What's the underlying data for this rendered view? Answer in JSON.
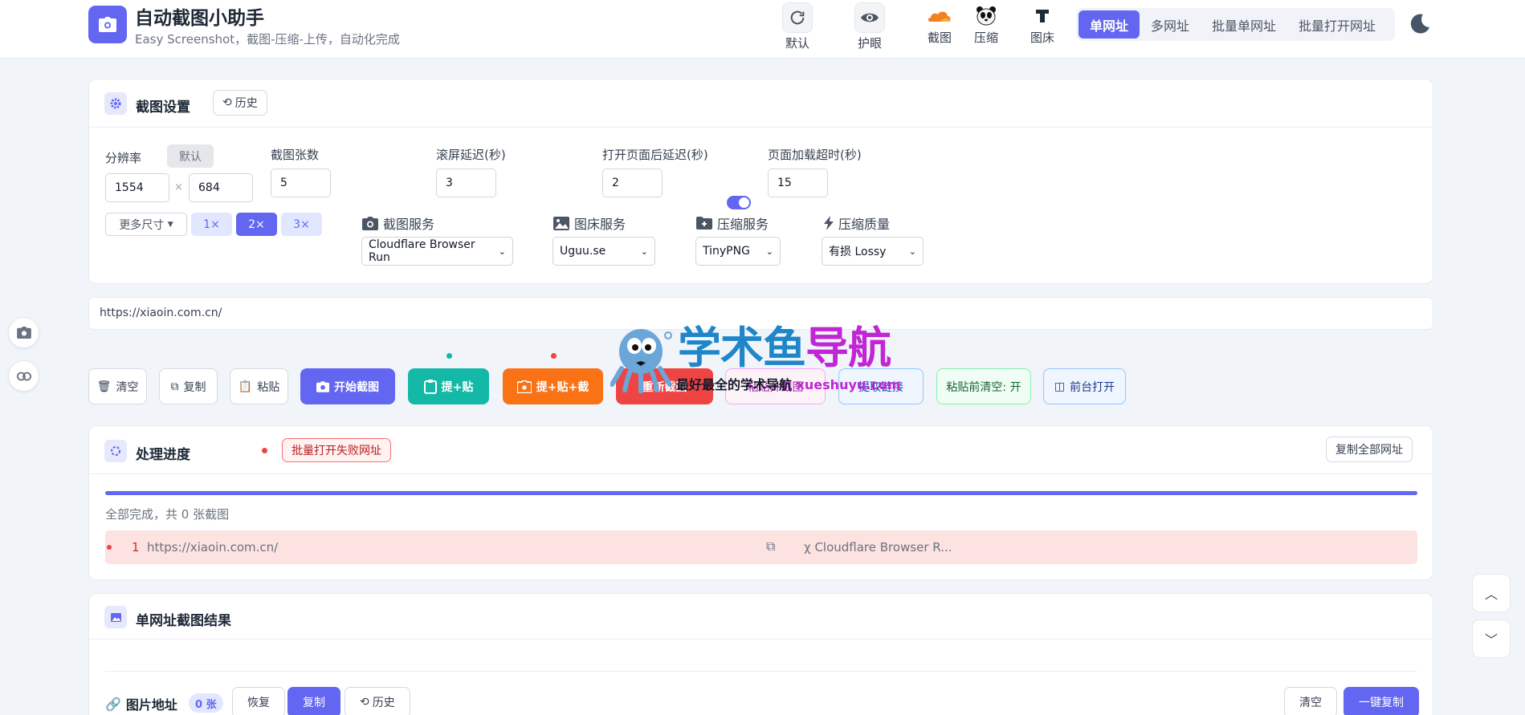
{
  "header": {
    "title": "自动截图小助手",
    "subtitle": "Easy Screenshot，截图-压缩-上传，自动化完成",
    "buttons": {
      "default": "默认",
      "eye": "护眼"
    },
    "services": {
      "screenshot": "截图",
      "compress": "压缩",
      "imagehost": "图床"
    },
    "modes": [
      "单网址",
      "多网址",
      "批量单网址",
      "批量打开网址"
    ]
  },
  "settings": {
    "title": "截图设置",
    "history": "历史",
    "resolution_label": "分辨率",
    "default_chip": "默认",
    "width": "1554",
    "height": "684",
    "times": "×",
    "more_sizes": "更多尺寸",
    "scales": [
      "1×",
      "2×",
      "3×"
    ],
    "count_label": "截图张数",
    "count": "5",
    "scroll_label": "滚屏延迟(秒)",
    "scroll": "3",
    "open_delay_label": "打开页面后延迟(秒)",
    "open_delay": "2",
    "timeout_label": "页面加载超时(秒)",
    "timeout": "15",
    "screenshot_service_label": "截图服务",
    "screenshot_service": "Cloudflare Browser Run",
    "imagehost_label": "图床服务",
    "imagehost": "Uguu.se",
    "compress_label": "压缩服务",
    "compress": "TinyPNG",
    "quality_label": "压缩质量",
    "quality": "有损 Lossy"
  },
  "url_input": {
    "value": "https://xiaoin.com.cn/"
  },
  "actions": {
    "clear": "清空",
    "copy": "复制",
    "paste": "粘贴",
    "start": "开始截图",
    "paste_combo": "提+贴",
    "paste_capture": "提+贴+截",
    "red_btn": "重新截图",
    "pink_btn": "粘贴并截图",
    "blue_btn": "提取链接",
    "clear_before_paste": "粘贴前清空: 开",
    "foreground_open": "前台打开"
  },
  "watermark": {
    "brand_a": "学术鱼",
    "brand_b": "导航",
    "tagline": "最好最全的学术导航",
    "domain": "xueshuyu.com"
  },
  "progress": {
    "title": "处理进度",
    "failed_btn": "批量打开失败网址",
    "copy_all": "复制全部网址",
    "status": "全部完成，共 0 张截图",
    "row": {
      "index": "1",
      "url": "https://xiaoin.com.cn/",
      "service": "Cloudflare Browser R..."
    },
    "percent": 100
  },
  "results": {
    "title": "单网址截图结果",
    "image_url_label": "图片地址",
    "count_badge": "0 张",
    "restore": "恢复",
    "copy": "复制",
    "history": "历史",
    "clear": "清空",
    "copy_all": "一键复制"
  },
  "colors": {
    "accent": "#6366f1",
    "teal": "#14b8a6",
    "orange": "#f97316",
    "red": "#ef4444"
  }
}
